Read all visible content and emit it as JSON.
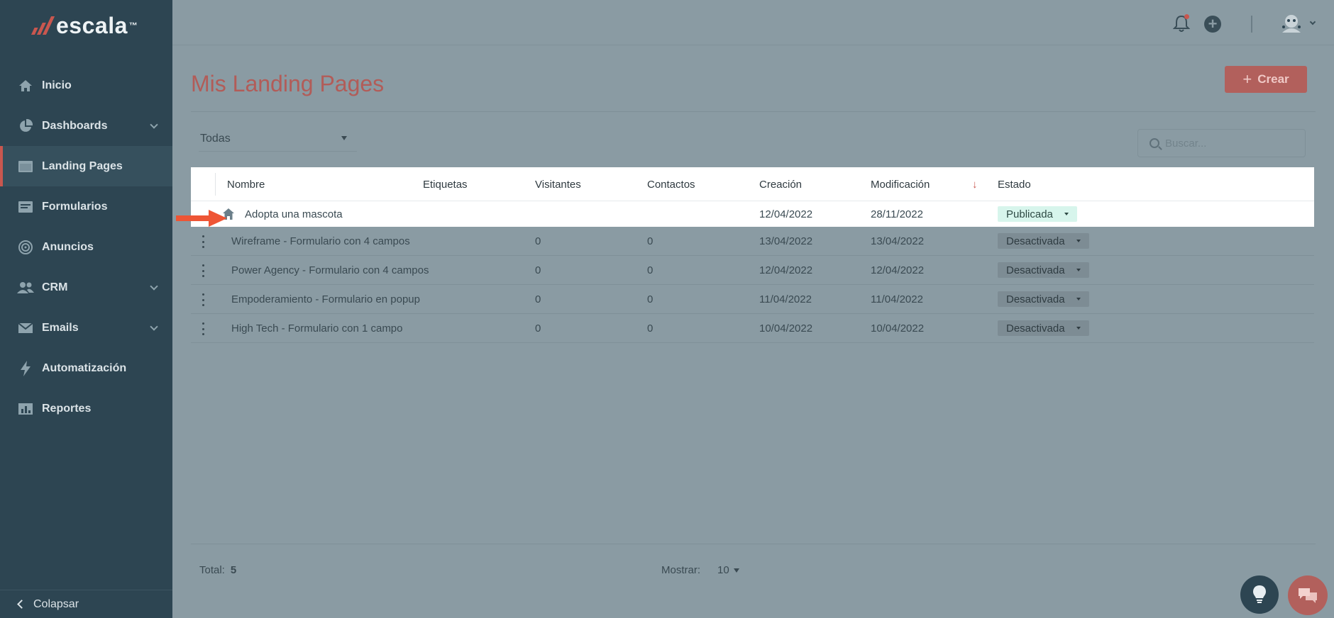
{
  "app": {
    "logo": "escala",
    "logo_tm": "™"
  },
  "sidebar": {
    "items": [
      {
        "label": "Inicio",
        "icon": "home-icon",
        "has_chevron": false
      },
      {
        "label": "Dashboards",
        "icon": "pie-chart-icon",
        "has_chevron": true
      },
      {
        "label": "Landing Pages",
        "icon": "window-icon",
        "has_chevron": false,
        "active": true
      },
      {
        "label": "Formularios",
        "icon": "form-icon",
        "has_chevron": false
      },
      {
        "label": "Anuncios",
        "icon": "target-icon",
        "has_chevron": false
      },
      {
        "label": "CRM",
        "icon": "users-icon",
        "has_chevron": true
      },
      {
        "label": "Emails",
        "icon": "envelope-icon",
        "has_chevron": true
      },
      {
        "label": "Automatización",
        "icon": "bolt-icon",
        "has_chevron": false
      },
      {
        "label": "Reportes",
        "icon": "report-icon",
        "has_chevron": false
      }
    ],
    "collapse_label": "Colapsar"
  },
  "header": {
    "title": "Mis Landing Pages",
    "create_label": "Crear"
  },
  "filters": {
    "selected": "Todas",
    "search_placeholder": "Buscar..."
  },
  "table": {
    "columns": [
      "Nombre",
      "Etiquetas",
      "Visitantes",
      "Contactos",
      "Creación",
      "Modificación",
      "Estado"
    ],
    "rows": [
      {
        "name": "Adopta una mascota",
        "tags": "",
        "visitors": "",
        "contacts": "",
        "created": "12/04/2022",
        "modified": "28/11/2022",
        "status": "Publicada"
      },
      {
        "name": "Wireframe - Formulario con 4 campos",
        "tags": "",
        "visitors": "0",
        "contacts": "0",
        "created": "13/04/2022",
        "modified": "13/04/2022",
        "status": "Desactivada"
      },
      {
        "name": "Power Agency - Formulario con 4 campos",
        "tags": "",
        "visitors": "0",
        "contacts": "0",
        "created": "12/04/2022",
        "modified": "12/04/2022",
        "status": "Desactivada"
      },
      {
        "name": "Empoderamiento - Formulario en popup",
        "tags": "",
        "visitors": "0",
        "contacts": "0",
        "created": "11/04/2022",
        "modified": "11/04/2022",
        "status": "Desactivada"
      },
      {
        "name": "High Tech - Formulario con 1 campo",
        "tags": "",
        "visitors": "0",
        "contacts": "0",
        "created": "10/04/2022",
        "modified": "10/04/2022",
        "status": "Desactivada"
      }
    ]
  },
  "footer": {
    "total_label": "Total:",
    "total_value": "5",
    "show_label": "Mostrar:",
    "show_value": "10"
  },
  "colors": {
    "sidebar_bg": "#2d4552",
    "accent": "#c9574f",
    "overlay": "#8a9ba3",
    "published_bg": "#d7f5ec"
  }
}
